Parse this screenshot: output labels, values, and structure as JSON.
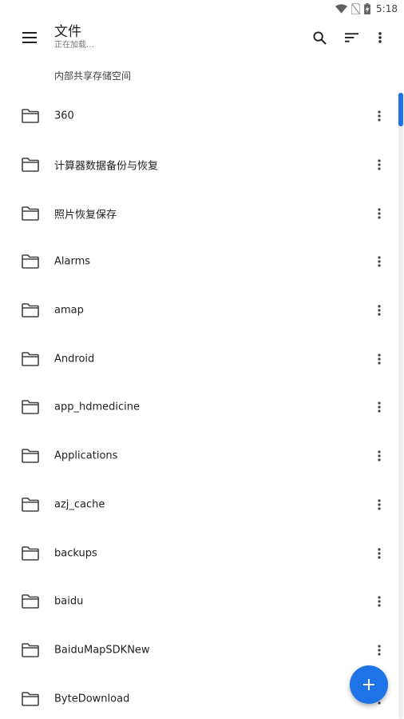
{
  "status_bar": {
    "time": "5:18",
    "icons": [
      "wifi-icon",
      "no-sim-icon",
      "battery-charging-icon"
    ]
  },
  "app_bar": {
    "title": "文件",
    "subtitle": "正在加载…",
    "icons": [
      "menu-icon",
      "search-icon",
      "sort-icon",
      "more-vert-icon"
    ]
  },
  "breadcrumb": {
    "label": "内部共享存储空间"
  },
  "files": [
    {
      "name": "360",
      "icon": "folder-icon"
    },
    {
      "name": "计算器数据备份与恢复",
      "icon": "folder-icon"
    },
    {
      "name": "照片恢复保存",
      "icon": "folder-icon"
    },
    {
      "name": "Alarms",
      "icon": "folder-icon"
    },
    {
      "name": "amap",
      "icon": "folder-icon"
    },
    {
      "name": "Android",
      "icon": "folder-icon"
    },
    {
      "name": "app_hdmedicine",
      "icon": "folder-icon"
    },
    {
      "name": "Applications",
      "icon": "folder-icon"
    },
    {
      "name": "azj_cache",
      "icon": "folder-icon"
    },
    {
      "name": "backups",
      "icon": "folder-icon"
    },
    {
      "name": "baidu",
      "icon": "folder-icon"
    },
    {
      "name": "BaiduMapSDKNew",
      "icon": "folder-icon"
    },
    {
      "name": "ByteDownload",
      "icon": "folder-icon"
    }
  ],
  "fab": {
    "icon": "add-icon"
  },
  "colors": {
    "accent": "#1e73e6",
    "scroll_thumb": "#1a73e8",
    "icon": "#424242",
    "text": "#212121",
    "subtext": "#757575"
  }
}
